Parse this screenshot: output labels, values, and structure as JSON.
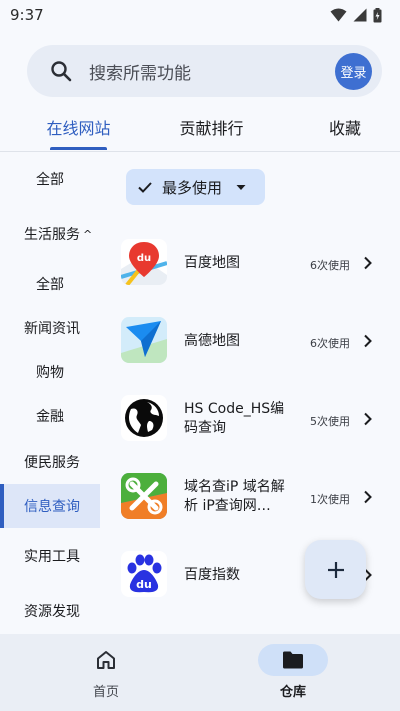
{
  "status_bar": {
    "time": "9:37"
  },
  "search": {
    "placeholder": "搜索所需功能",
    "login_label": "登录"
  },
  "tabs": [
    {
      "label": "在线网站",
      "active": true
    },
    {
      "label": "贡献排行",
      "active": false
    },
    {
      "label": "收藏",
      "active": false
    }
  ],
  "sidebar": {
    "items": [
      {
        "label": "全部"
      },
      {
        "label": "生活服务"
      },
      {
        "label": "全部"
      },
      {
        "label": "新闻资讯"
      },
      {
        "label": "购物"
      },
      {
        "label": "金融"
      },
      {
        "label": "便民服务"
      },
      {
        "label": "信息查询"
      },
      {
        "label": "实用工具"
      },
      {
        "label": "资源发现"
      }
    ],
    "active_label": "信息查询"
  },
  "filter": {
    "label": "最多使用"
  },
  "sites": [
    {
      "name": "百度地图",
      "count": "6次使用",
      "icon": "baidu-map-icon"
    },
    {
      "name": "高德地图",
      "count": "6次使用",
      "icon": "amap-icon"
    },
    {
      "name": "HS Code_HS编码查询",
      "count": "5次使用",
      "icon": "globe-icon"
    },
    {
      "name": "域名查iP 域名解析 iP查询网…",
      "count": "1次使用",
      "icon": "tools-icon"
    },
    {
      "name": "百度指数",
      "count": "",
      "icon": "baidu-paw-icon"
    }
  ],
  "bottom_nav": [
    {
      "label": "首页",
      "active": false,
      "icon": "home-icon"
    },
    {
      "label": "仓库",
      "active": true,
      "icon": "folder-icon"
    }
  ],
  "colors": {
    "accent": "#2f5ec0",
    "login_button": "#3e6fd1",
    "chip_bg": "#d3e3fb"
  }
}
